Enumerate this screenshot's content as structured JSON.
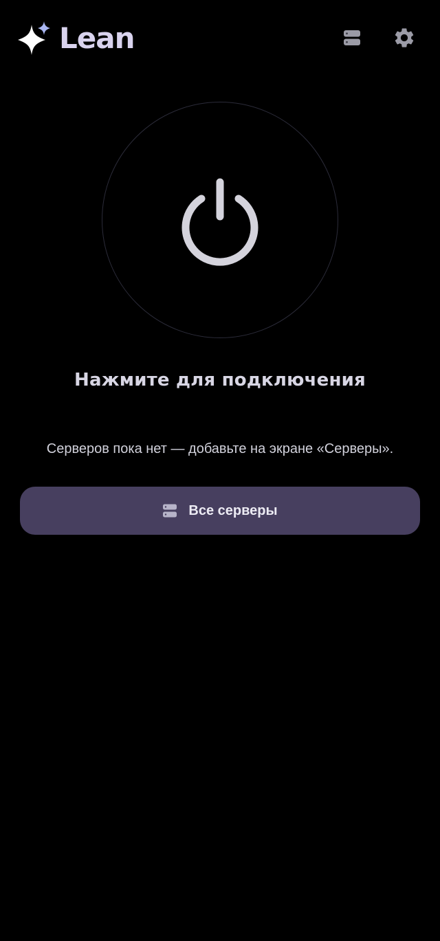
{
  "header": {
    "app_name": "Lean",
    "logo_icon": "sparkle-icon",
    "servers_icon": "server-stack-icon",
    "settings_icon": "gear-icon"
  },
  "main": {
    "power_icon": "power-icon",
    "connect_title": "Нажмите для подключения",
    "empty_hint": "Серверов пока нет — добавьте на экране «Серверы».",
    "all_servers_button": {
      "label": "Все серверы",
      "icon": "server-stack-icon"
    }
  },
  "colors": {
    "background": "#000000",
    "button_bg": "#473f5f",
    "logo_text": "#d9d3ee",
    "icon_grey": "#9b9ba6",
    "power_icon": "#d4d3dc",
    "ring_border": "#2c2c3a",
    "sparkle_accent": "#a9b6f1"
  }
}
